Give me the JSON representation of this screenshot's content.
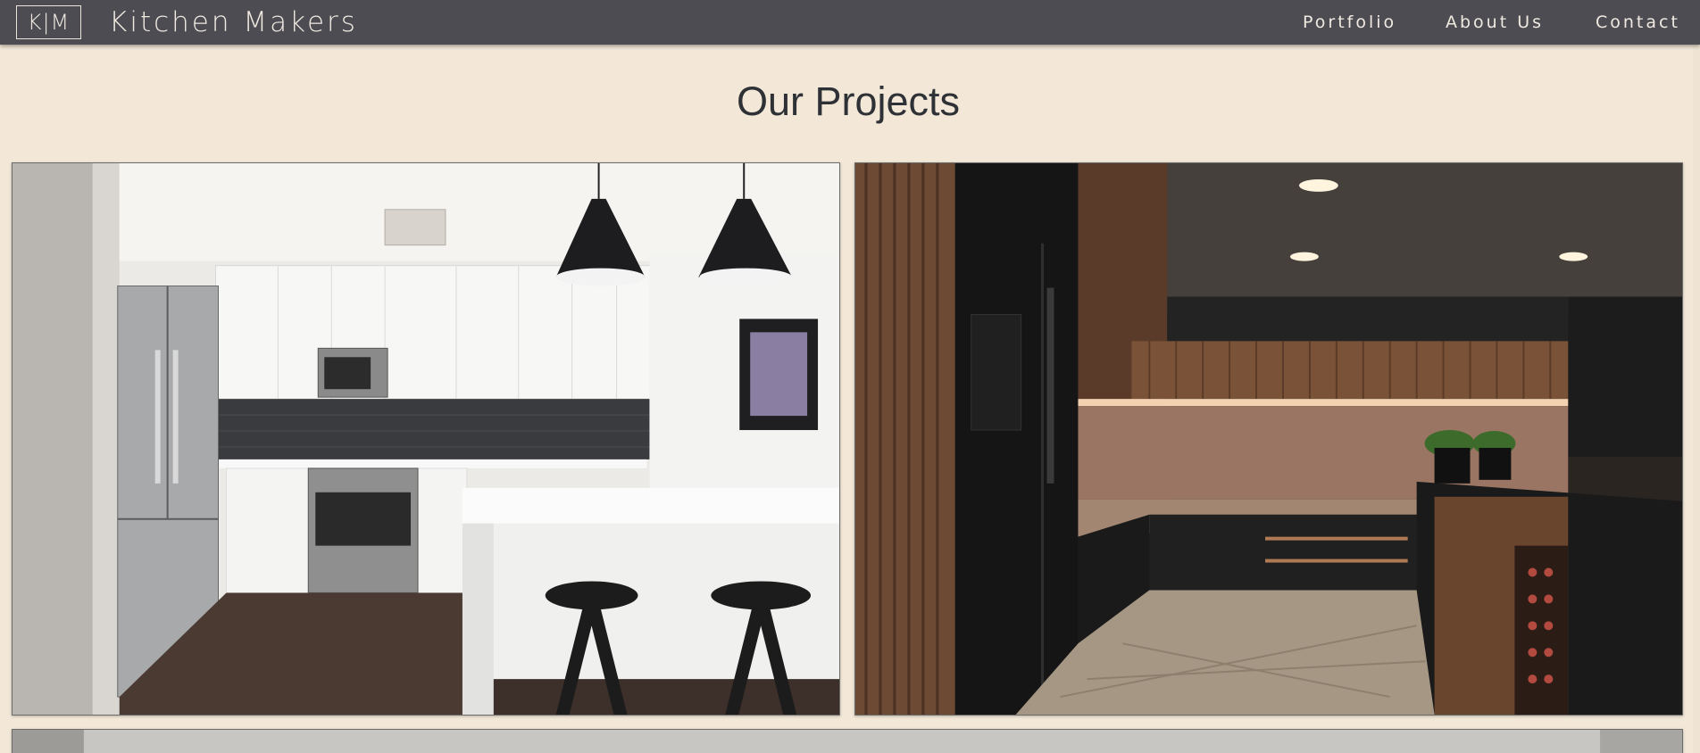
{
  "navbar": {
    "logo_text": "K|M",
    "brand": "Kitchen Makers",
    "links": {
      "portfolio": "Portfolio",
      "about": "About Us",
      "contact": "Contact"
    }
  },
  "main": {
    "title": "Our Projects"
  },
  "colors": {
    "navbar_bg": "#4c4c52",
    "page_bg": "#f3e8d8",
    "title_text": "#2e3136",
    "nav_text": "#efe9e0"
  }
}
